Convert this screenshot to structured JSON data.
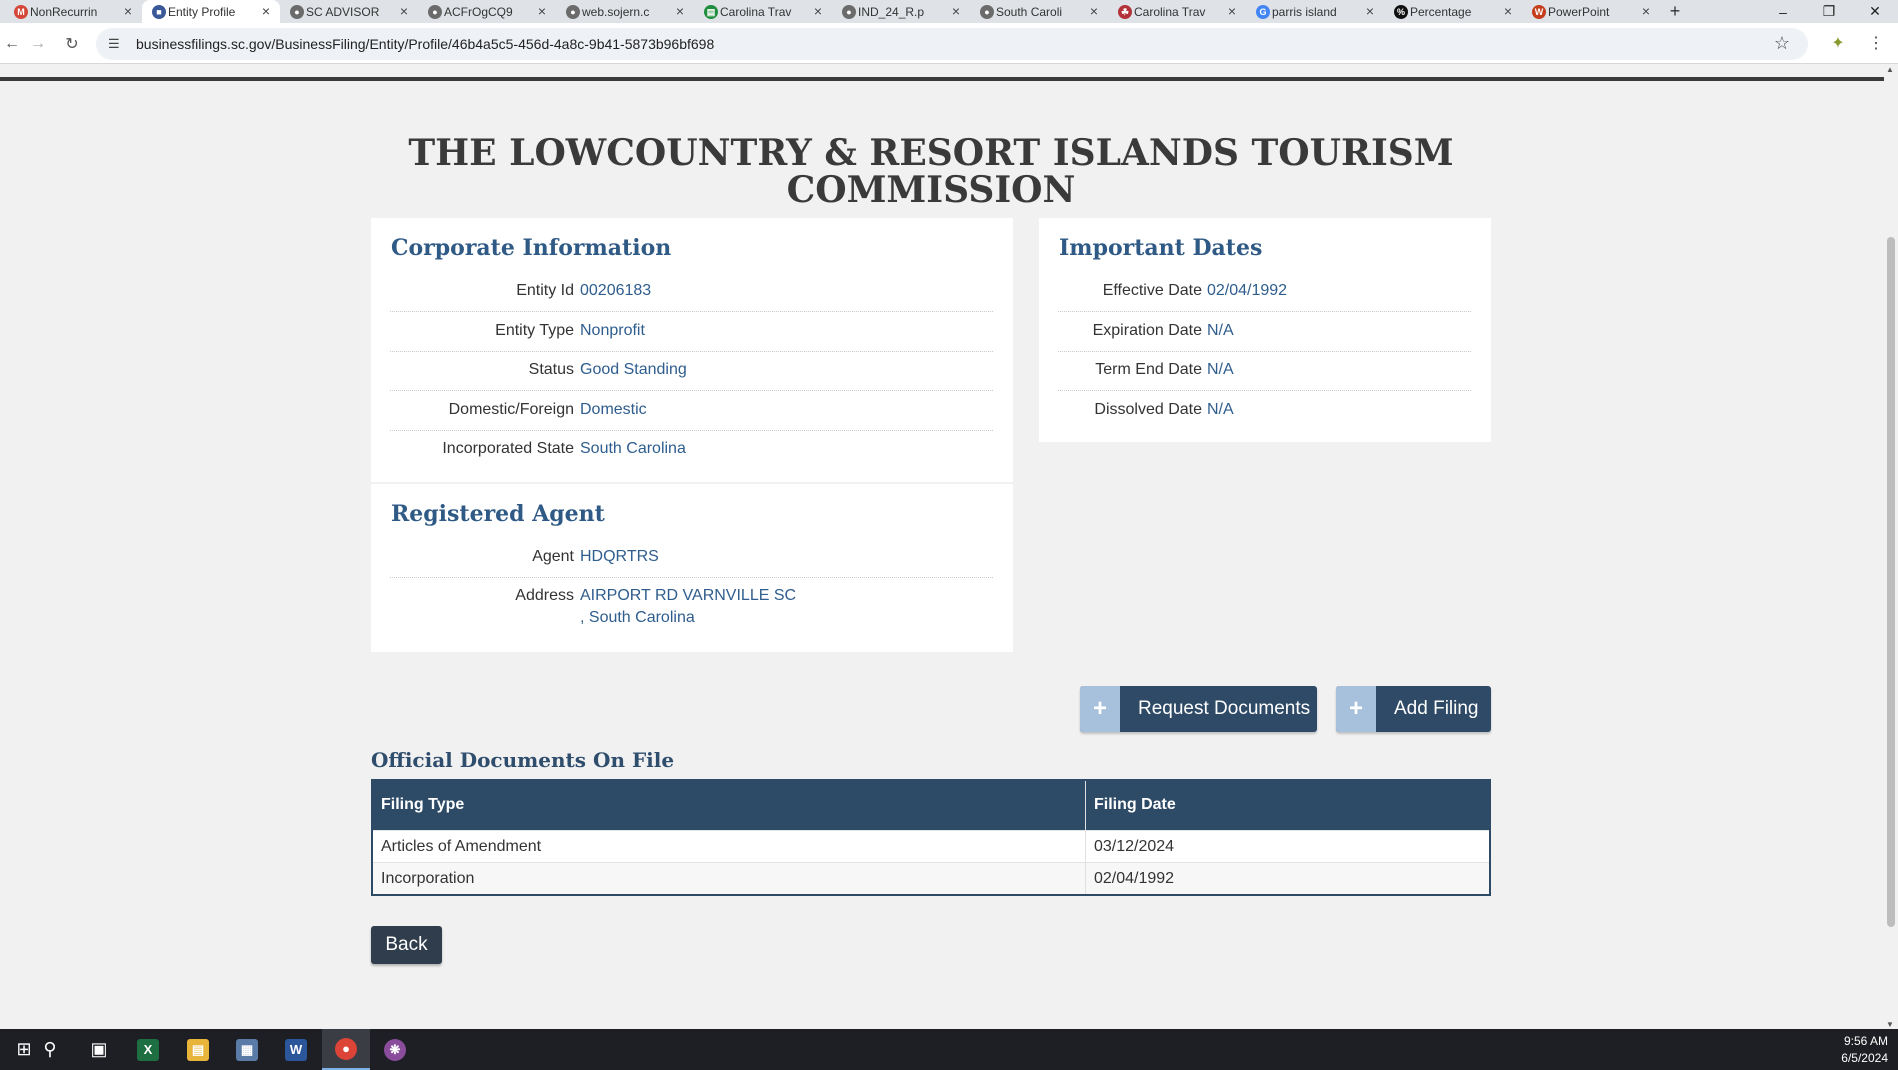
{
  "browser": {
    "tabs": [
      {
        "label": "NonRecurrin",
        "icon": "gmail-icon",
        "glyph": "M",
        "color": "#d44638"
      },
      {
        "label": "Entity Profile",
        "icon": "page-icon",
        "glyph": "■",
        "color": "#3b5998",
        "active": true
      },
      {
        "label": "SC ADVISOR",
        "icon": "globe-icon",
        "glyph": "●",
        "color": "#6b6b6b"
      },
      {
        "label": "ACFrOgCQ9",
        "icon": "globe-icon",
        "glyph": "●",
        "color": "#6b6b6b"
      },
      {
        "label": "web.sojern.c",
        "icon": "globe-icon",
        "glyph": "●",
        "color": "#6b6b6b"
      },
      {
        "label": "Carolina Trav",
        "icon": "sheets-icon",
        "glyph": "▤",
        "color": "#1e8e3e"
      },
      {
        "label": "IND_24_R.p",
        "icon": "globe-icon",
        "glyph": "●",
        "color": "#6b6b6b"
      },
      {
        "label": "South Caroli",
        "icon": "globe-icon",
        "glyph": "●",
        "color": "#6b6b6b"
      },
      {
        "label": "Carolina Trav",
        "icon": "travel-icon",
        "glyph": "☘",
        "color": "#b3333a"
      },
      {
        "label": "parris island",
        "icon": "google-icon",
        "glyph": "G",
        "color": "#4285f4"
      },
      {
        "label": "Percentage",
        "icon": "percent-icon",
        "glyph": "%",
        "color": "#111111"
      },
      {
        "label": "PowerPoint",
        "icon": "powerpoint-icon",
        "glyph": "W",
        "color": "#c43e1c"
      }
    ],
    "new_tab": "+",
    "win_min": "–",
    "win_restore": "❐",
    "win_close": "✕",
    "url": "businessfilings.sc.gov/BusinessFiling/Entity/Profile/46b4a5c5-456d-4a8c-9b41-5873b96bf698"
  },
  "page": {
    "title": "THE LOWCOUNTRY & RESORT ISLANDS TOURISM COMMISSION",
    "corporate": {
      "heading": "Corporate Information",
      "rows": [
        {
          "label": "Entity Id",
          "value": "00206183"
        },
        {
          "label": "Entity Type",
          "value": "Nonprofit"
        },
        {
          "label": "Status",
          "value": "Good Standing"
        },
        {
          "label": "Domestic/Foreign",
          "value": "Domestic"
        },
        {
          "label": "Incorporated State",
          "value": "South Carolina"
        }
      ]
    },
    "dates": {
      "heading": "Important Dates",
      "rows": [
        {
          "label": "Effective Date",
          "value": "02/04/1992"
        },
        {
          "label": "Expiration Date",
          "value": "N/A"
        },
        {
          "label": "Term End Date",
          "value": "N/A"
        },
        {
          "label": "Dissolved Date",
          "value": "N/A"
        }
      ]
    },
    "agent": {
      "heading": "Registered Agent",
      "agent_label": "Agent",
      "agent_value": "HDQRTRS",
      "address_label": "Address",
      "address_line1": "AIRPORT RD VARNVILLE SC",
      "address_line2": ", South Carolina"
    },
    "buttons": {
      "request_documents": "Request Documents",
      "add_filing": "Add Filing",
      "plus": "+",
      "back": "Back"
    },
    "documents": {
      "heading": "Official Documents On File",
      "columns": [
        "Filing Type",
        "Filing Date"
      ],
      "rows": [
        [
          "Articles of Amendment",
          "03/12/2024"
        ],
        [
          "Incorporation",
          "02/04/1992"
        ]
      ]
    }
  },
  "taskbar": {
    "time": "9:56 AM",
    "date": "6/5/2024"
  },
  "colors": {
    "heading_blue": "#2f5a86",
    "value_blue": "#2e5d8e",
    "table_header": "#2d4a66",
    "button_dark": "#2e4a66",
    "button_plus": "#a7c0db"
  }
}
